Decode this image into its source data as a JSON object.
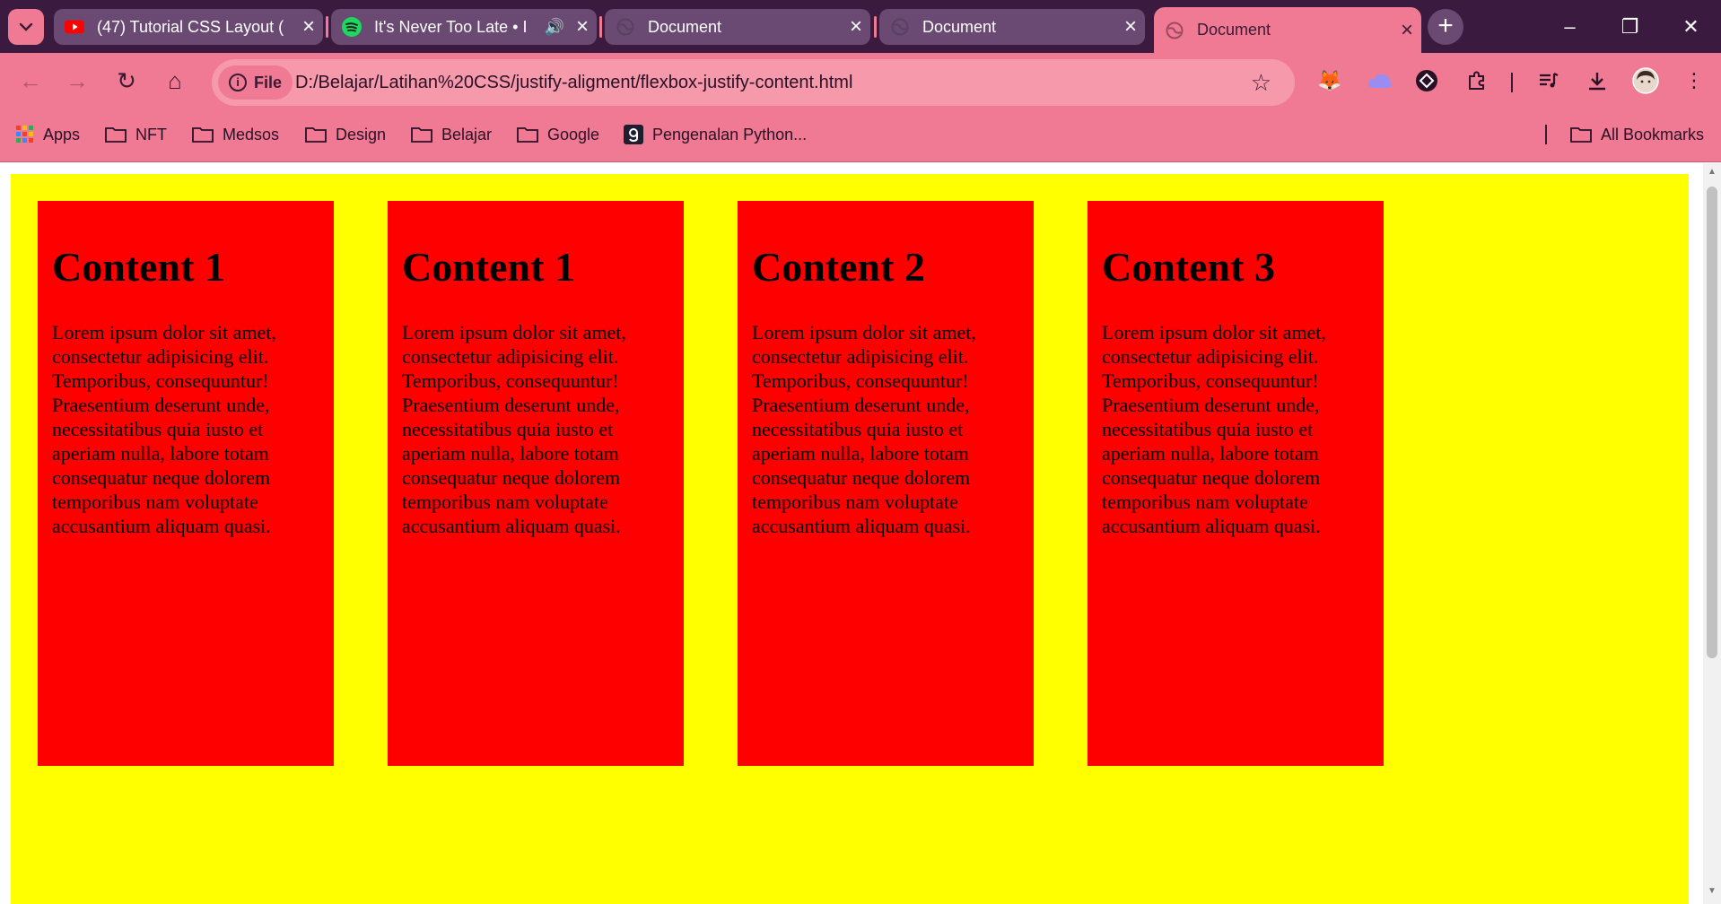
{
  "browser": {
    "tabs": [
      {
        "title": "(47) Tutorial CSS Layout (",
        "favicon": "youtube-icon",
        "active": false
      },
      {
        "title": "It's Never Too Late • I",
        "favicon": "spotify-icon",
        "active": false,
        "audio": true
      },
      {
        "title": "Document",
        "favicon": "globe-icon",
        "active": false
      },
      {
        "title": "Document",
        "favicon": "globe-icon",
        "active": false
      },
      {
        "title": "Document",
        "favicon": "globe-icon",
        "active": true
      }
    ],
    "new_tab_label": "+",
    "window_controls": {
      "minimize": "–",
      "restore": "❐",
      "close": "✕"
    },
    "nav": {
      "back": "←",
      "forward": "→",
      "reload": "↻",
      "home": "⌂"
    },
    "omnibox": {
      "scheme_chip": "File",
      "url": "D:/Belajar/Latihan%20CSS/justify-aligment/flexbox-justify-content.html",
      "star": "☆"
    },
    "extensions": [
      "metamask-icon",
      "cloud-icon",
      "diamond-icon",
      "puzzle-icon",
      "media-icon",
      "download-icon",
      "avatar",
      "kebab-menu-icon"
    ],
    "bookmarks": [
      {
        "label": "Apps",
        "icon": "apps-grid-icon"
      },
      {
        "label": "NFT",
        "icon": "folder-icon"
      },
      {
        "label": "Medsos",
        "icon": "folder-icon"
      },
      {
        "label": "Design",
        "icon": "folder-icon"
      },
      {
        "label": "Belajar",
        "icon": "folder-icon"
      },
      {
        "label": "Google",
        "icon": "folder-icon"
      },
      {
        "label": "Pengenalan Python...",
        "icon": "site-g-icon"
      }
    ],
    "all_bookmarks": "All Bookmarks",
    "colors": {
      "titlebar": "#3b1a3f",
      "toolbar": "#f07a93",
      "container": "#ffff00",
      "card": "#ff0000"
    }
  },
  "page": {
    "cards": [
      {
        "heading": "Content 1",
        "body": "Lorem ipsum dolor sit amet, consectetur adipisicing elit. Temporibus, consequuntur! Praesentium deserunt unde, necessitatibus quia iusto et aperiam nulla, labore totam consequatur neque dolorem temporibus nam voluptate accusantium aliquam quasi."
      },
      {
        "heading": "Content 1",
        "body": "Lorem ipsum dolor sit amet, consectetur adipisicing elit. Temporibus, consequuntur! Praesentium deserunt unde, necessitatibus quia iusto et aperiam nulla, labore totam consequatur neque dolorem temporibus nam voluptate accusantium aliquam quasi."
      },
      {
        "heading": "Content 2",
        "body": "Lorem ipsum dolor sit amet, consectetur adipisicing elit. Temporibus, consequuntur! Praesentium deserunt unde, necessitatibus quia iusto et aperiam nulla, labore totam consequatur neque dolorem temporibus nam voluptate accusantium aliquam quasi."
      },
      {
        "heading": "Content 3",
        "body": "Lorem ipsum dolor sit amet, consectetur adipisicing elit. Temporibus, consequuntur! Praesentium deserunt unde, necessitatibus quia iusto et aperiam nulla, labore totam consequatur neque dolorem temporibus nam voluptate accusantium aliquam quasi."
      }
    ]
  }
}
